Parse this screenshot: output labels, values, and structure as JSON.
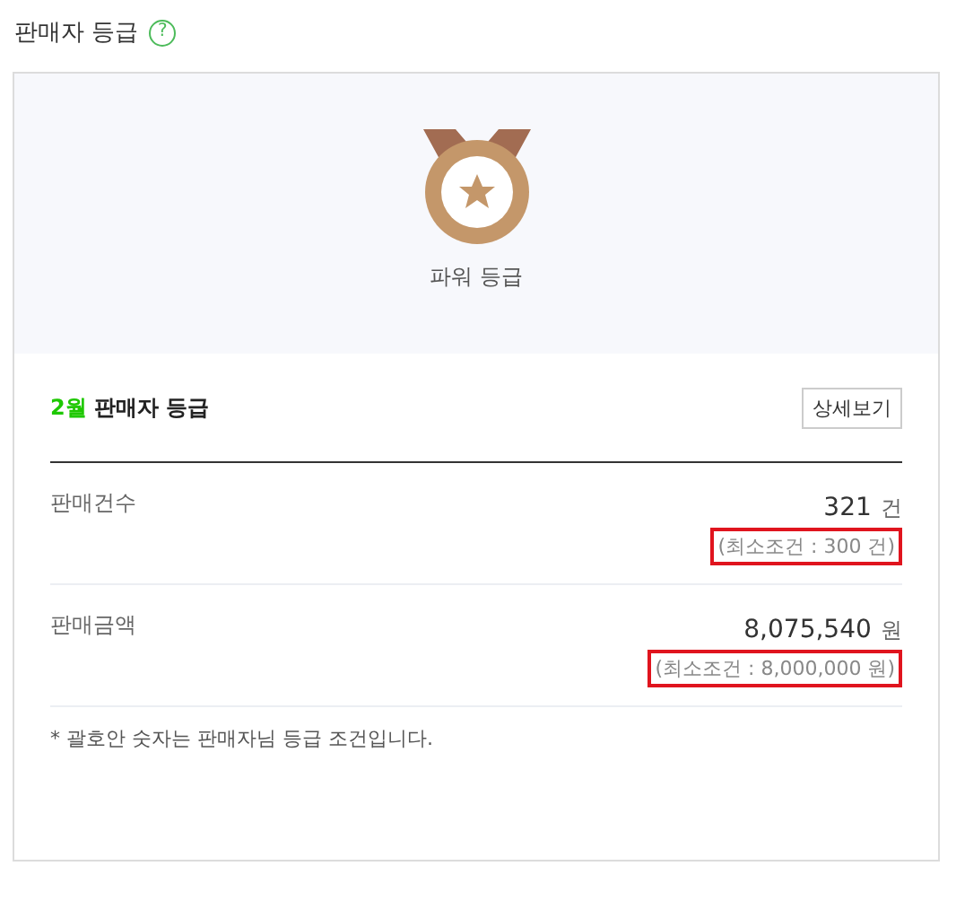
{
  "title": "판매자 등급",
  "help_icon": "?",
  "grade": {
    "label": "파워 등급"
  },
  "summary": {
    "month": "2월",
    "heading": "판매자 등급",
    "detail_button": "상세보기"
  },
  "stats": [
    {
      "label": "판매건수",
      "value": "321",
      "unit": "건",
      "condition": "(최소조건 : 300 건)",
      "highlighted": true
    },
    {
      "label": "판매금액",
      "value": "8,075,540",
      "unit": "원",
      "condition": "(최소조건 : 8,000,000 원)",
      "highlighted": true
    }
  ],
  "note": "* 괄호안 숫자는 판매자님 등급 조건입니다."
}
